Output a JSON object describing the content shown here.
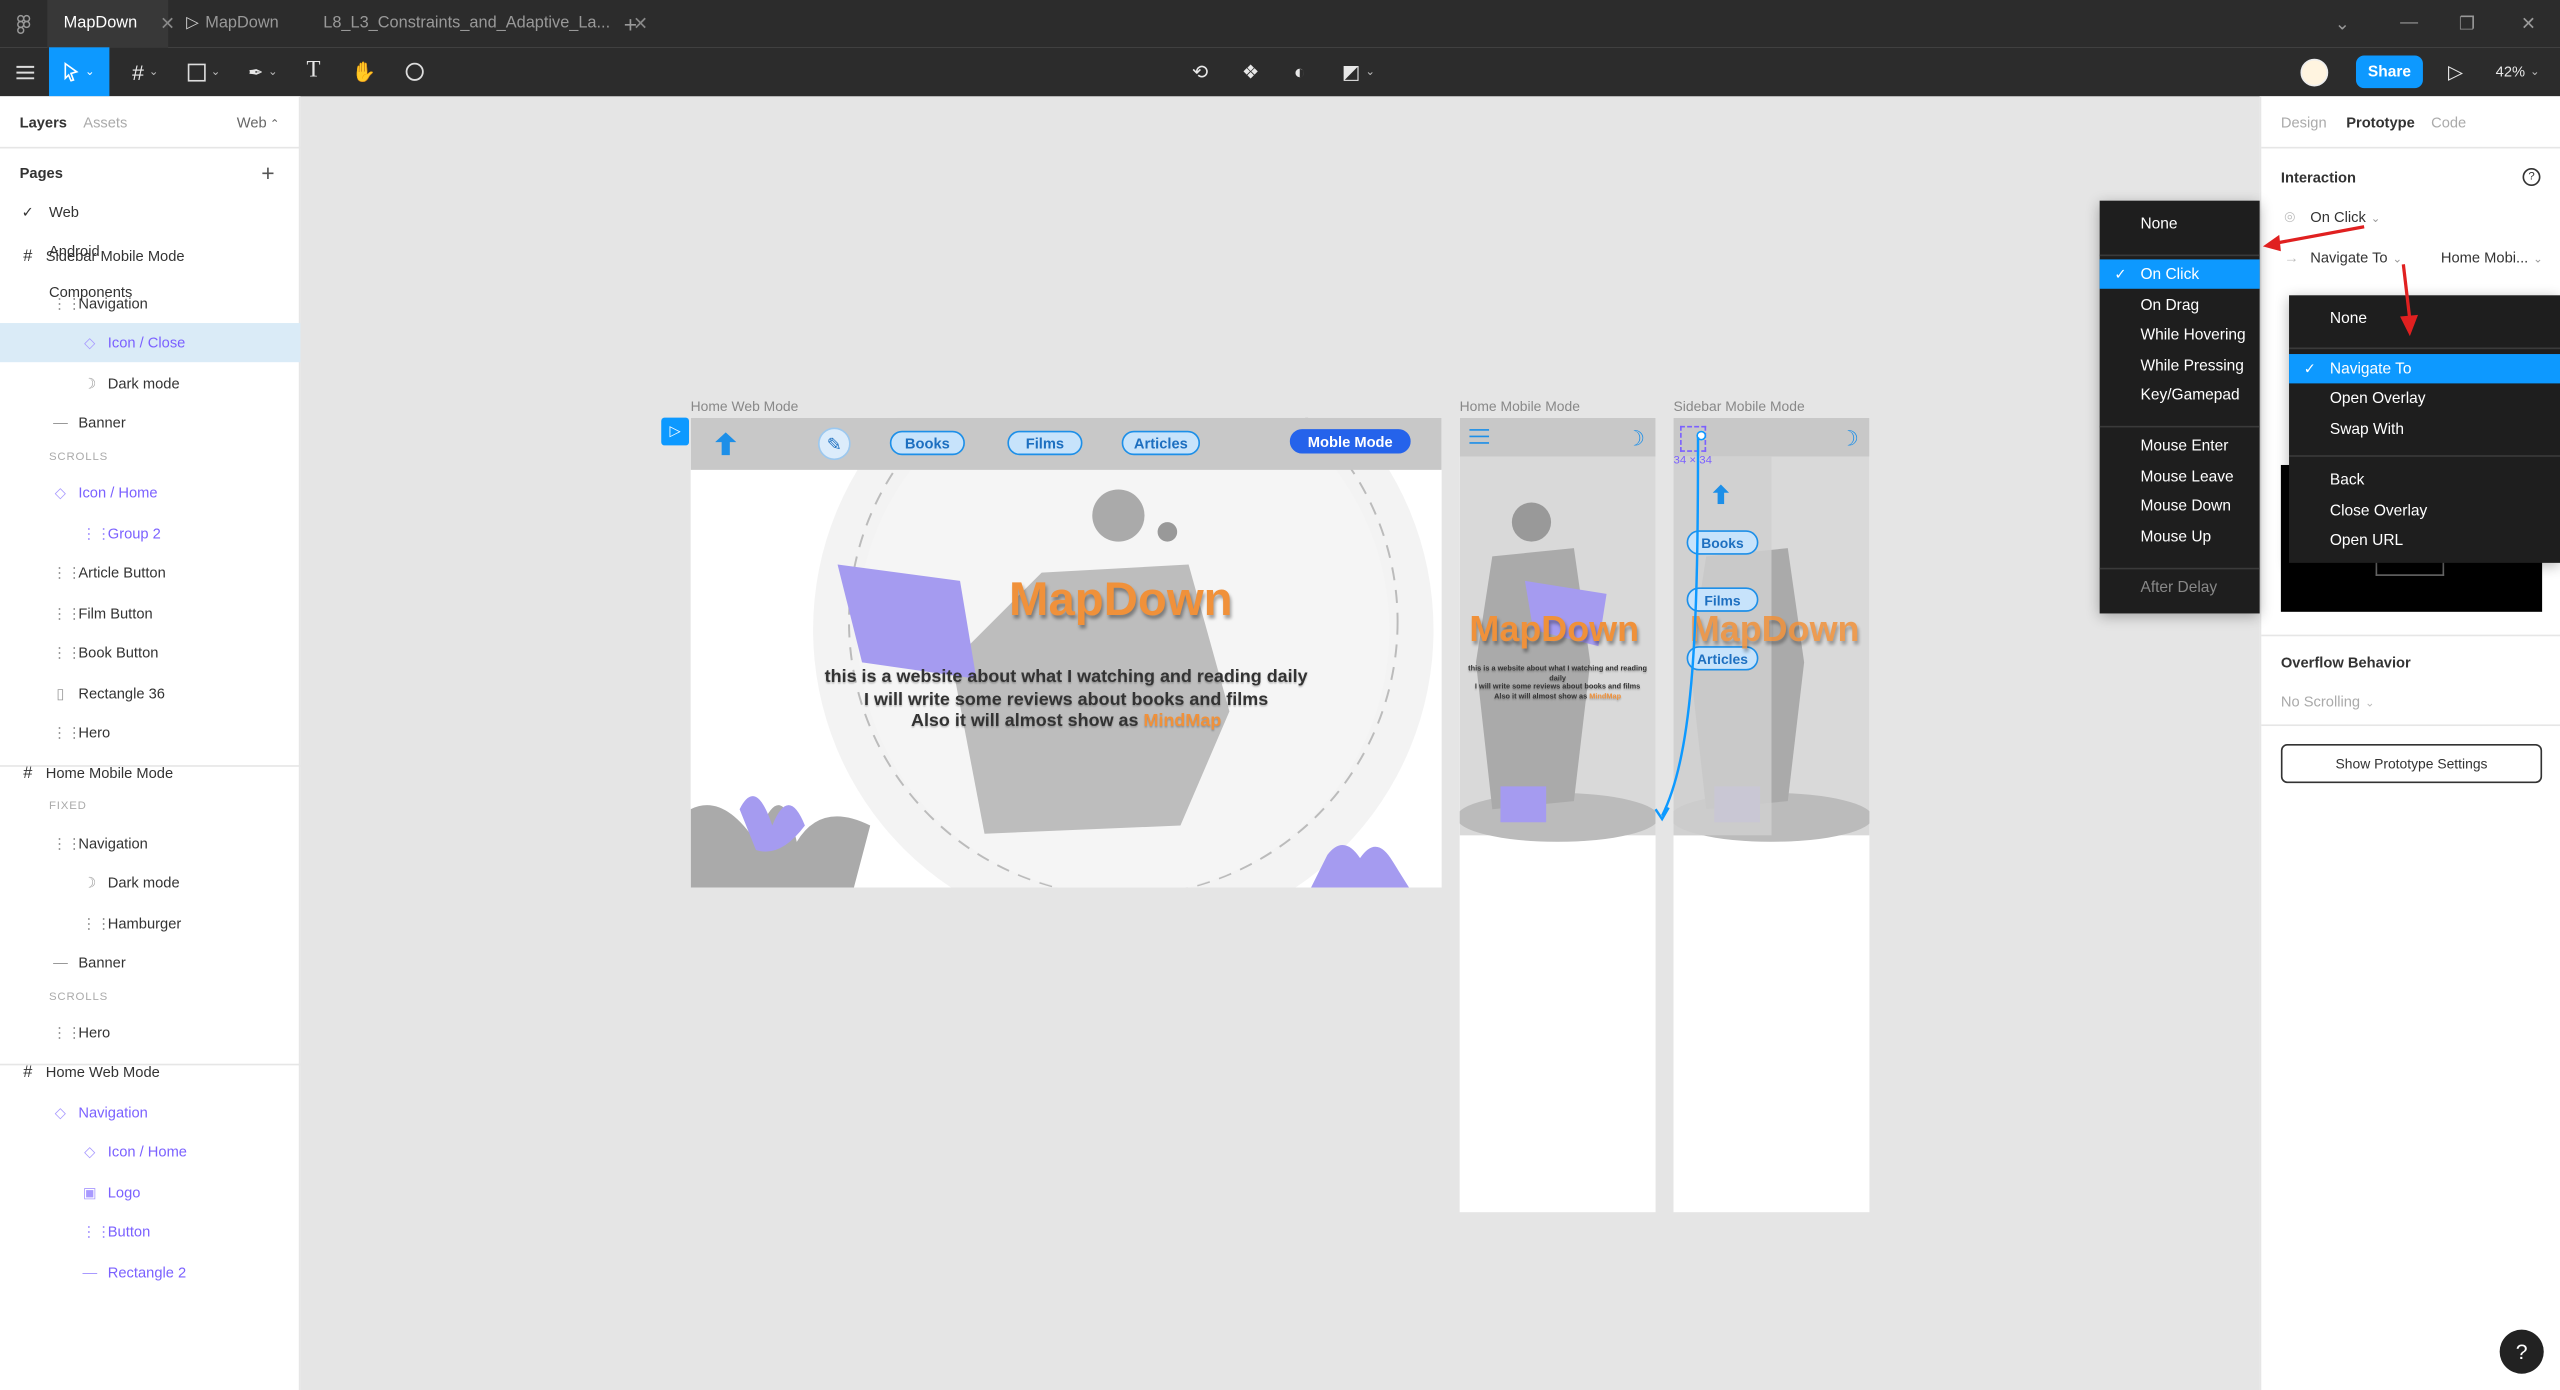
{
  "tabs": [
    {
      "label": "MapDown"
    },
    {
      "label": "MapDown"
    },
    {
      "label": "L8_L3_Constraints_and_Adaptive_La..."
    }
  ],
  "toolbar": {
    "zoom": "42%",
    "share": "Share"
  },
  "left": {
    "tab_layers": "Layers",
    "tab_assets": "Assets",
    "page_select": "Web",
    "pages_title": "Pages",
    "pages": [
      "Web",
      "Android",
      "Components"
    ],
    "layers": [
      {
        "label": "Sidebar Mobile Mode",
        "kind": "frame"
      },
      {
        "label": "Navigation",
        "kind": "group"
      },
      {
        "label": "Icon / Close",
        "kind": "component"
      },
      {
        "label": "Dark mode",
        "kind": "moon"
      },
      {
        "label": "Banner",
        "kind": "line"
      },
      {
        "label": "SCROLLS",
        "kind": "section"
      },
      {
        "label": "Icon / Home",
        "kind": "component"
      },
      {
        "label": "Group 2",
        "kind": "group"
      },
      {
        "label": "Article Button",
        "kind": "group"
      },
      {
        "label": "Film Button",
        "kind": "group"
      },
      {
        "label": "Book Button",
        "kind": "group"
      },
      {
        "label": "Rectangle 36",
        "kind": "rect"
      },
      {
        "label": "Hero",
        "kind": "group"
      },
      {
        "label": "Home Mobile Mode",
        "kind": "frame"
      },
      {
        "label": "FIXED",
        "kind": "section"
      },
      {
        "label": "Navigation",
        "kind": "group"
      },
      {
        "label": "Dark mode",
        "kind": "moon"
      },
      {
        "label": "Hamburger",
        "kind": "group"
      },
      {
        "label": "Banner",
        "kind": "line"
      },
      {
        "label": "SCROLLS",
        "kind": "section"
      },
      {
        "label": "Hero",
        "kind": "group"
      },
      {
        "label": "Home Web Mode",
        "kind": "frame"
      },
      {
        "label": "Navigation",
        "kind": "component"
      },
      {
        "label": "Icon / Home",
        "kind": "component"
      },
      {
        "label": "Logo",
        "kind": "image"
      },
      {
        "label": "Button",
        "kind": "group"
      },
      {
        "label": "Rectangle 2",
        "kind": "line"
      }
    ]
  },
  "right": {
    "tab_design": "Design",
    "tab_prototype": "Prototype",
    "tab_code": "Code",
    "interaction_title": "Interaction",
    "trigger": "On Click",
    "action": "Navigate To",
    "destination": "Home Mobi...",
    "overflow_title": "Overflow Behavior",
    "overflow_value": "No Scrolling",
    "show_settings": "Show Prototype Settings"
  },
  "canvas": {
    "frame_web": "Home Web Mode",
    "frame_mobile": "Home Mobile Mode",
    "frame_sidebar": "Sidebar Mobile Mode",
    "nav_books": "Books",
    "nav_films": "Films",
    "nav_articles": "Articles",
    "mobile_mode": "Moble Mode",
    "hero_title": "MapDown",
    "hero_line1": "this is a website about what I watching and reading daily",
    "hero_line2": "I will write some reviews about books and films",
    "hero_line3": "Also it will almost show as ",
    "hero_highlight": "MindMap",
    "size_label": "34 × 34",
    "sidebar_buttons": [
      "Books",
      "Films",
      "Articles"
    ]
  },
  "trigger_menu": {
    "items": [
      "None",
      "On Click",
      "On Drag",
      "While Hovering",
      "While Pressing",
      "Key/Gamepad",
      "Mouse Enter",
      "Mouse Leave",
      "Mouse Down",
      "Mouse Up",
      "After Delay"
    ],
    "selected": "On Click"
  },
  "action_menu": {
    "items": [
      "None",
      "Navigate To",
      "Open Overlay",
      "Swap With",
      "Back",
      "Close Overlay",
      "Open URL"
    ],
    "selected": "Navigate To"
  },
  "colors": {
    "accent": "#0d99ff",
    "brand_orange": "#f0913a",
    "component_purple": "#7b61ff",
    "annotation_red": "#e02020"
  }
}
